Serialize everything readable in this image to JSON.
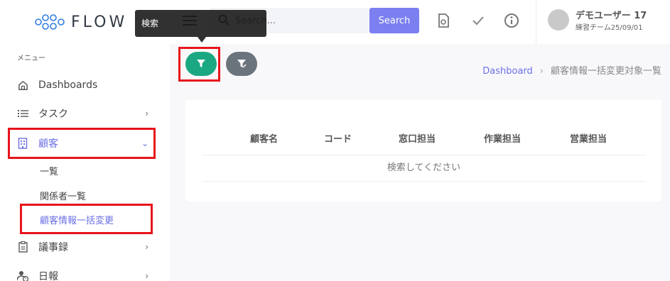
{
  "header": {
    "logo_text": "FLOW",
    "search_placeholder": "Search...",
    "search_button": "Search",
    "user_name": "デモユーザー 17",
    "user_team": "練習チーム25/09/01"
  },
  "tooltip": {
    "text": "検索"
  },
  "sidebar": {
    "menu_title": "メニュー",
    "items": [
      {
        "label": "Dashboards",
        "icon": "home-icon"
      },
      {
        "label": "タスク",
        "icon": "list-icon"
      },
      {
        "label": "顧客",
        "icon": "building-icon"
      },
      {
        "label": "議事録",
        "icon": "clipboard-icon"
      },
      {
        "label": "日報",
        "icon": "user-clock-icon"
      }
    ],
    "sub_items": [
      {
        "label": "一覧"
      },
      {
        "label": "関係者一覧"
      },
      {
        "label": "顧客情報一括変更"
      }
    ]
  },
  "breadcrumb": {
    "home": "Dashboard",
    "current": "顧客情報一括変更対象一覧"
  },
  "table": {
    "columns": [
      "顧客名",
      "コード",
      "窓口担当",
      "作業担当",
      "営業担当"
    ],
    "empty_message": "検索してください"
  },
  "colors": {
    "accent": "#7b7ff0",
    "active_text": "#6c70e6",
    "filter_green": "#1aa882",
    "clear_grey": "#6b747d",
    "highlight_red": "#e8141b"
  }
}
